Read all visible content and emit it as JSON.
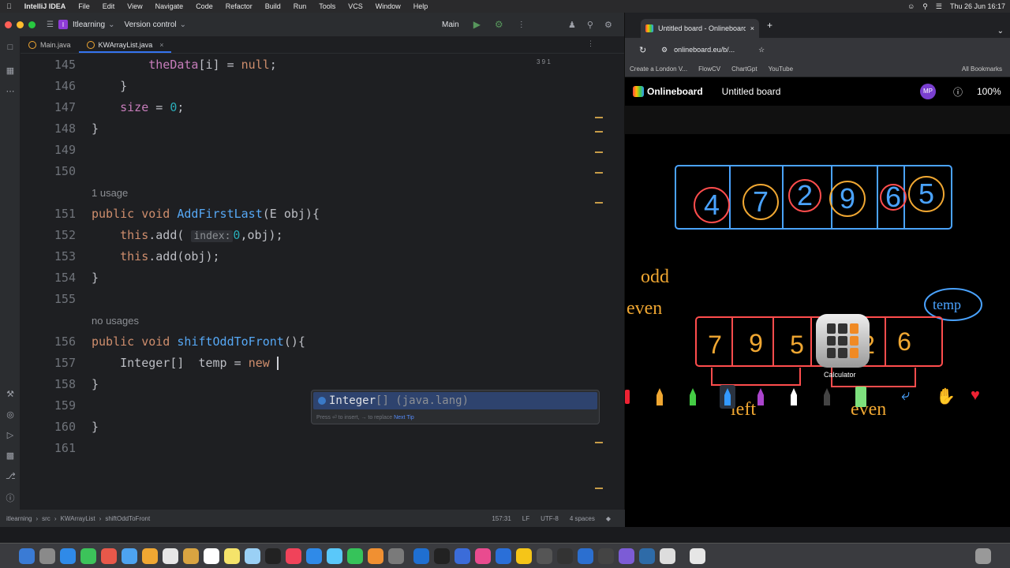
{
  "menubar": {
    "app": "IntelliJ IDEA",
    "items": [
      "File",
      "Edit",
      "View",
      "Navigate",
      "Code",
      "Refactor",
      "Build",
      "Run",
      "Tools",
      "VCS",
      "Window",
      "Help"
    ],
    "clock": "Thu 26 Jun  16:17"
  },
  "ide": {
    "project_badge": "I",
    "project": "Itlearning",
    "vcs": "Version control",
    "run_config": "Main",
    "tabs": [
      {
        "label": "Main.java",
        "active": false
      },
      {
        "label": "KWArrayList.java",
        "active": true
      }
    ],
    "code_lines": [
      {
        "ln": "145",
        "code": "        theData[i] = null;"
      },
      {
        "ln": "146",
        "code": "    }"
      },
      {
        "ln": "147",
        "code": "    size = 0;"
      },
      {
        "ln": "148",
        "code": "}"
      },
      {
        "ln": "149",
        "code": ""
      },
      {
        "ln": "150",
        "code": ""
      },
      {
        "ln": "",
        "usage": "1 usage"
      },
      {
        "ln": "151",
        "code": "public void AddFirstLast(E obj){"
      },
      {
        "ln": "152",
        "code": "    this.add( index: 0,obj);"
      },
      {
        "ln": "153",
        "code": "    this.add(obj);"
      },
      {
        "ln": "154",
        "code": "}"
      },
      {
        "ln": "155",
        "code": ""
      },
      {
        "ln": "",
        "usage": "no usages"
      },
      {
        "ln": "156",
        "code": "public void shiftOddToFront(){"
      },
      {
        "ln": "157",
        "code": "    Integer[]  temp = new "
      },
      {
        "ln": "158",
        "code": "}"
      },
      {
        "ln": "159",
        "code": ""
      },
      {
        "ln": "160",
        "code": "}"
      },
      {
        "ln": "161",
        "code": ""
      }
    ],
    "inspection": "3  9  1",
    "completion": {
      "name": "Integer",
      "suffix": "[] (java.lang)",
      "tip_text": "Press ⏎ to insert, → to replace",
      "tip_link": "Next Tip"
    },
    "status": {
      "breadcrumb": [
        "itlearning",
        "src",
        "KWArrayList",
        "shiftOddToFront"
      ],
      "position": "157:31",
      "line_sep": "LF",
      "encoding": "UTF-8",
      "indent": "4 spaces"
    }
  },
  "browser": {
    "tab_title": "Untitled board - Onlineboard",
    "url": "onlineboard.eu/b/...",
    "bookmarks": [
      "Create a London V...",
      "FlowCV",
      "ChartGpt",
      "YouTube"
    ],
    "all_bookmarks": "All Bookmarks",
    "app_name": "Onlineboard",
    "board_title": "Untitled board",
    "avatar": "MP",
    "zoom": "100%",
    "board": {
      "top_array": [
        "4",
        "7",
        "2",
        "9",
        "6",
        "5"
      ],
      "bottom_array": [
        "7",
        "9",
        "5",
        "4",
        "2",
        "6"
      ],
      "notes": [
        "odd",
        "even",
        "temp",
        "left",
        "even"
      ]
    }
  },
  "dock": {
    "calculator_label": "Calculator"
  }
}
